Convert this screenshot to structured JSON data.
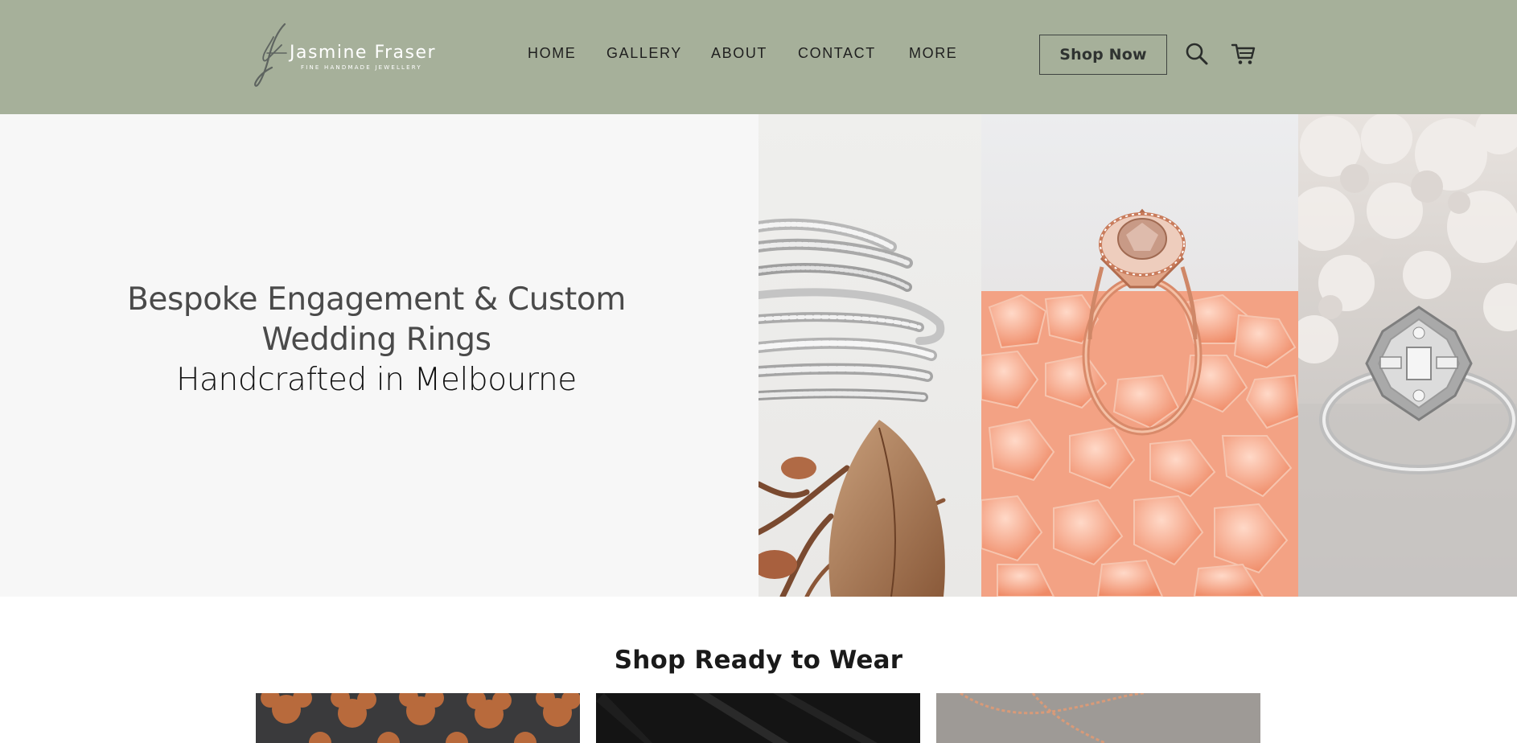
{
  "brand": {
    "name": "Jasmine Fraser",
    "tagline": "FINE HANDMADE JEWELLERY",
    "monogram": "JF"
  },
  "nav": {
    "items": [
      {
        "label": "HOME"
      },
      {
        "label": "GALLERY"
      },
      {
        "label": "ABOUT"
      },
      {
        "label": "CONTACT"
      },
      {
        "label": "MORE"
      }
    ]
  },
  "header": {
    "shop_button": "Shop Now",
    "search_icon": "search-icon",
    "cart_icon": "cart-icon",
    "background": "#a6b09a"
  },
  "hero": {
    "line1": "Bespoke Engagement & Custom",
    "line2": "Wedding Rings",
    "line3": "Handcrafted in Melbourne",
    "images": [
      "stacked-diamond-rings-image",
      "rose-gold-halo-ring-image",
      "white-gold-vintage-ring-image"
    ]
  },
  "shop": {
    "title": "Shop Ready to Wear",
    "products": [
      "copper-pattern-product-image",
      "black-product-image",
      "rose-gold-necklace-product-image"
    ]
  }
}
